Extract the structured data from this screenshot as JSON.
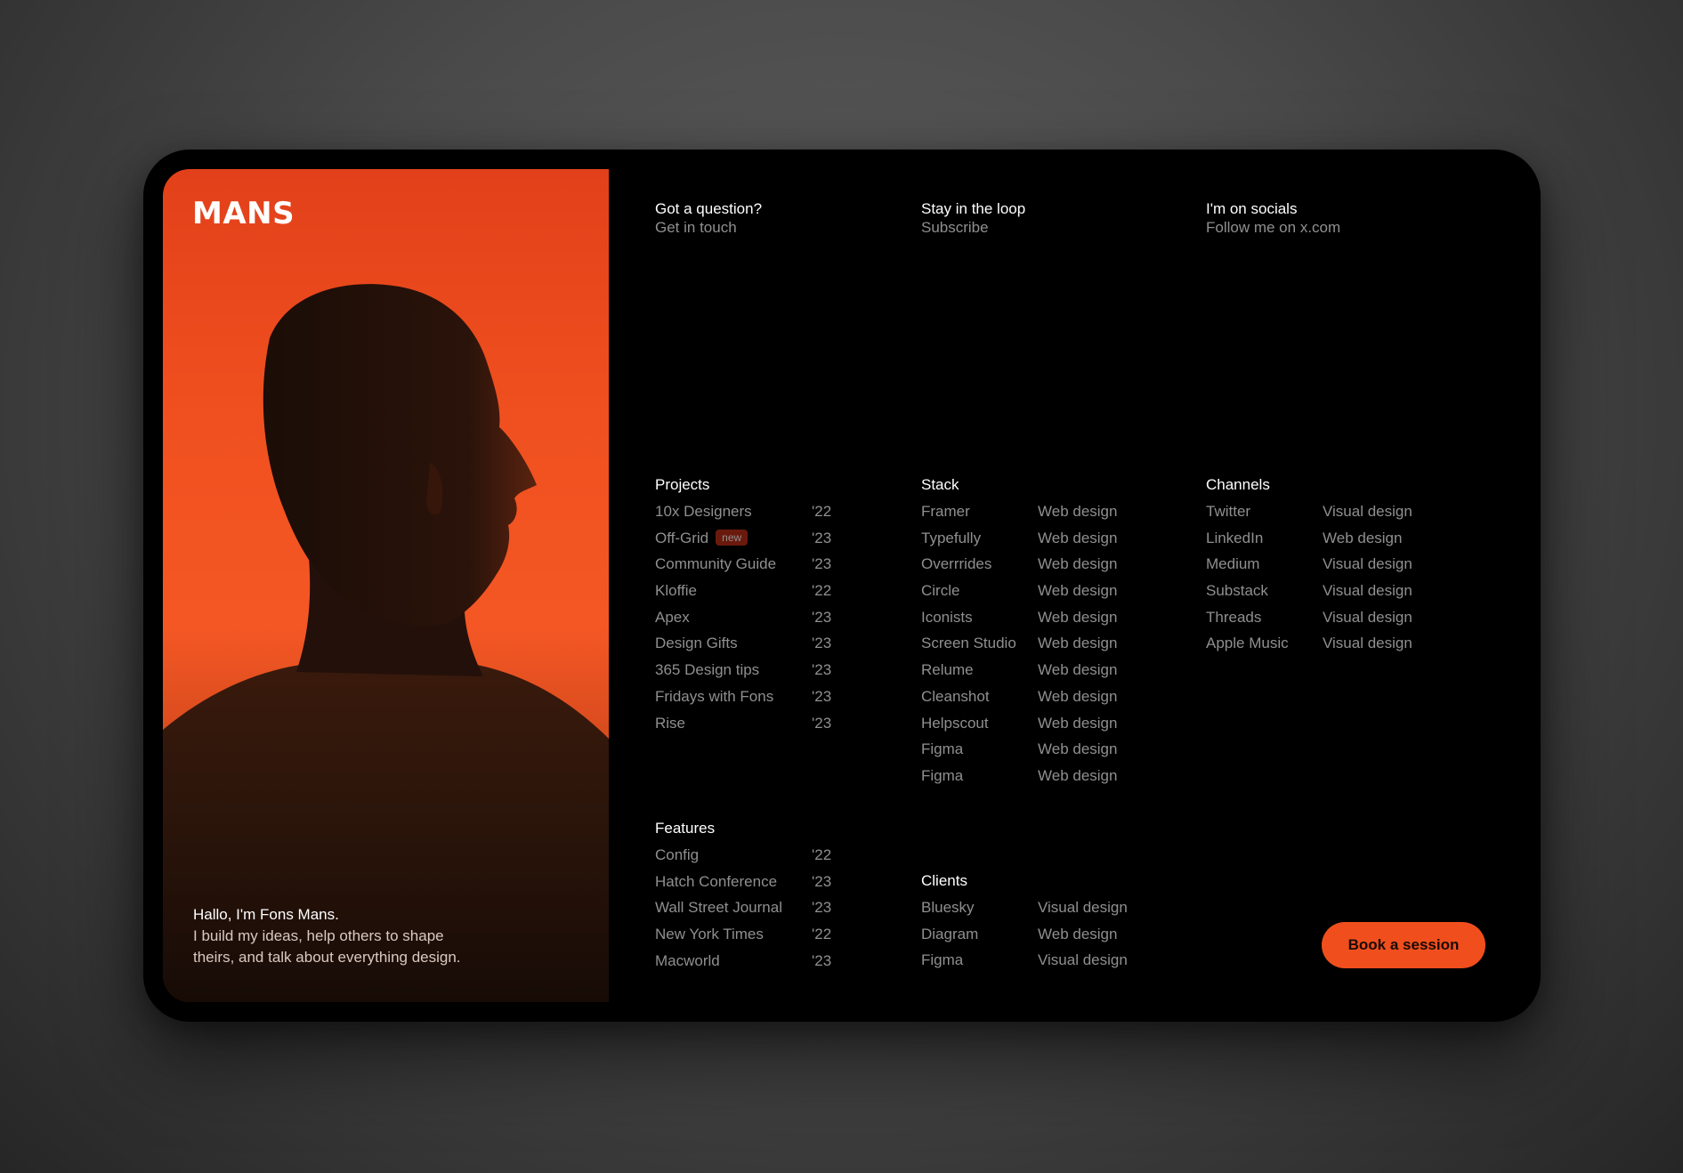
{
  "brand": {
    "logo": "MANS",
    "accent": "#f04f1d"
  },
  "intro": {
    "greeting": "Hallo, I'm Fons Mans.",
    "line1": "I build my ideas, help others to shape",
    "line2": "theirs, and talk about everything design."
  },
  "contact": {
    "question": {
      "title": "Got a question?",
      "link": "Get in touch"
    },
    "loop": {
      "title": "Stay in the loop",
      "link": "Subscribe"
    },
    "socials": {
      "title": "I'm on socials",
      "link": "Follow me on x.com"
    }
  },
  "projects": {
    "title": "Projects",
    "badge": "new",
    "items": [
      {
        "name": "10x Designers",
        "year": "'22"
      },
      {
        "name": "Off-Grid",
        "year": "'23"
      },
      {
        "name": "Community Guide",
        "year": "'23"
      },
      {
        "name": "Kloffie",
        "year": "'22"
      },
      {
        "name": "Apex",
        "year": "'23"
      },
      {
        "name": "Design Gifts",
        "year": "'23"
      },
      {
        "name": "365 Design tips",
        "year": "'23"
      },
      {
        "name": "Fridays with Fons",
        "year": "'23"
      },
      {
        "name": "Rise",
        "year": "'23"
      }
    ]
  },
  "stack": {
    "title": "Stack",
    "items": [
      {
        "name": "Framer",
        "type": "Web design"
      },
      {
        "name": "Typefully",
        "type": "Web design"
      },
      {
        "name": "Overrrides",
        "type": "Web design"
      },
      {
        "name": "Circle",
        "type": "Web design"
      },
      {
        "name": "Iconists",
        "type": "Web design"
      },
      {
        "name": "Screen Studio",
        "type": "Web design"
      },
      {
        "name": "Relume",
        "type": "Web design"
      },
      {
        "name": "Cleanshot",
        "type": "Web design"
      },
      {
        "name": "Helpscout",
        "type": "Web design"
      },
      {
        "name": "Figma",
        "type": "Web design"
      },
      {
        "name": "Figma",
        "type": "Web design"
      }
    ]
  },
  "channels": {
    "title": "Channels",
    "items": [
      {
        "name": "Twitter",
        "type": "Visual design"
      },
      {
        "name": "LinkedIn",
        "type": "Web design"
      },
      {
        "name": "Medium",
        "type": "Visual design"
      },
      {
        "name": "Substack",
        "type": "Visual design"
      },
      {
        "name": "Threads",
        "type": "Visual design"
      },
      {
        "name": "Apple Music",
        "type": "Visual design"
      }
    ]
  },
  "features": {
    "title": "Features",
    "items": [
      {
        "name": "Config",
        "year": "'22"
      },
      {
        "name": "Hatch Conference",
        "year": "'23"
      },
      {
        "name": "Wall Street Journal",
        "year": "'23"
      },
      {
        "name": "New York Times",
        "year": "'22"
      },
      {
        "name": "Macworld",
        "year": "'23"
      }
    ]
  },
  "clients": {
    "title": "Clients",
    "items": [
      {
        "name": "Bluesky",
        "type": "Visual design"
      },
      {
        "name": "Diagram",
        "type": "Web design"
      },
      {
        "name": "Figma",
        "type": "Visual design"
      }
    ]
  },
  "cta": {
    "label": "Book a session"
  }
}
